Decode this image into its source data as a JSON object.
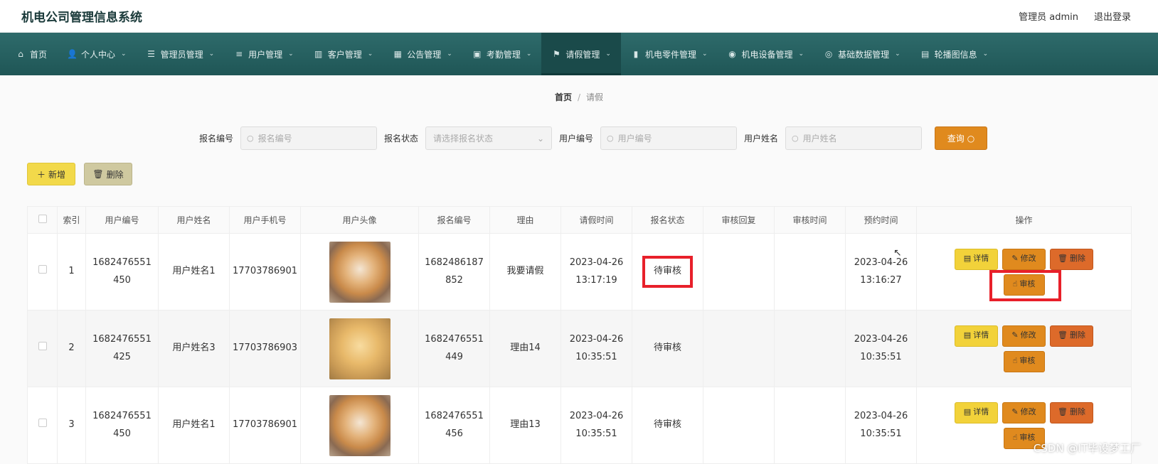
{
  "header": {
    "title": "机电公司管理信息系统",
    "admin_label": "管理员 admin",
    "logout_label": "退出登录"
  },
  "nav": {
    "items": [
      {
        "label": "首页",
        "icon": "home-icon",
        "glyph": "⌂",
        "dropdown": false
      },
      {
        "label": "个人中心",
        "icon": "user-icon",
        "glyph": "👤",
        "dropdown": true
      },
      {
        "label": "管理员管理",
        "icon": "sliders-icon",
        "glyph": "☰",
        "dropdown": true
      },
      {
        "label": "用户管理",
        "icon": "list-icon",
        "glyph": "≡",
        "dropdown": true
      },
      {
        "label": "客户管理",
        "icon": "bar-chart-icon",
        "glyph": "▥",
        "dropdown": true
      },
      {
        "label": "公告管理",
        "icon": "grid-icon",
        "glyph": "▦",
        "dropdown": true
      },
      {
        "label": "考勤管理",
        "icon": "wallet-icon",
        "glyph": "▣",
        "dropdown": true
      },
      {
        "label": "请假管理",
        "icon": "flag-icon",
        "glyph": "⚑",
        "dropdown": true
      },
      {
        "label": "机电零件管理",
        "icon": "chart-icon",
        "glyph": "▮",
        "dropdown": true
      },
      {
        "label": "机电设备管理",
        "icon": "microphone-icon",
        "glyph": "◉",
        "dropdown": true
      },
      {
        "label": "基础数据管理",
        "icon": "support-icon",
        "glyph": "◎",
        "dropdown": true
      },
      {
        "label": "轮播图信息",
        "icon": "image-chart-icon",
        "glyph": "▤",
        "dropdown": true
      }
    ],
    "active_index": 7
  },
  "breadcrumb": {
    "home": "首页",
    "separator": "/",
    "current": "请假"
  },
  "search": {
    "fields": [
      {
        "label": "报名编号",
        "placeholder": "报名编号",
        "type": "input"
      },
      {
        "label": "报名状态",
        "placeholder": "请选择报名状态",
        "type": "select"
      },
      {
        "label": "用户编号",
        "placeholder": "用户编号",
        "type": "input"
      },
      {
        "label": "用户姓名",
        "placeholder": "用户姓名",
        "type": "input"
      }
    ],
    "query_label": "查询"
  },
  "toolbar": {
    "add_label": "新增",
    "delete_label": "删除"
  },
  "table": {
    "columns": [
      "",
      "索引",
      "用户编号",
      "用户姓名",
      "用户手机号",
      "用户头像",
      "报名编号",
      "理由",
      "请假时间",
      "报名状态",
      "审核回复",
      "审核时间",
      "预约时间",
      "操作"
    ],
    "rows": [
      {
        "index": "1",
        "user_no": "1682476551450",
        "user_name": "用户姓名1",
        "phone": "17703786901",
        "avatar": "shiba",
        "sign_no": "1682486187852",
        "reason": "我要请假",
        "leave_time": "2023-04-26 13:17:19",
        "status": "待审核",
        "reply": "",
        "audit_time": "",
        "appt_time": "2023-04-26 13:16:27"
      },
      {
        "index": "2",
        "user_no": "1682476551425",
        "user_name": "用户姓名3",
        "phone": "17703786903",
        "avatar": "golden",
        "sign_no": "1682476551449",
        "reason": "理由14",
        "leave_time": "2023-04-26 10:35:51",
        "status": "待审核",
        "reply": "",
        "audit_time": "",
        "appt_time": "2023-04-26 10:35:51"
      },
      {
        "index": "3",
        "user_no": "1682476551450",
        "user_name": "用户姓名1",
        "phone": "17703786901",
        "avatar": "shiba",
        "sign_no": "1682476551456",
        "reason": "理由13",
        "leave_time": "2023-04-26 10:35:51",
        "status": "待审核",
        "reply": "",
        "audit_time": "",
        "appt_time": "2023-04-26 10:35:51"
      }
    ],
    "ops": {
      "detail": "详情",
      "edit": "修改",
      "remove": "删除",
      "audit": "审核"
    }
  },
  "watermark": "CSDN @IT毕设梦工厂",
  "colors": {
    "nav_bg": "#2e6b6b",
    "query_btn": "#e08a1e",
    "add_btn": "#f2d94a",
    "highlight": "#e8202a"
  }
}
